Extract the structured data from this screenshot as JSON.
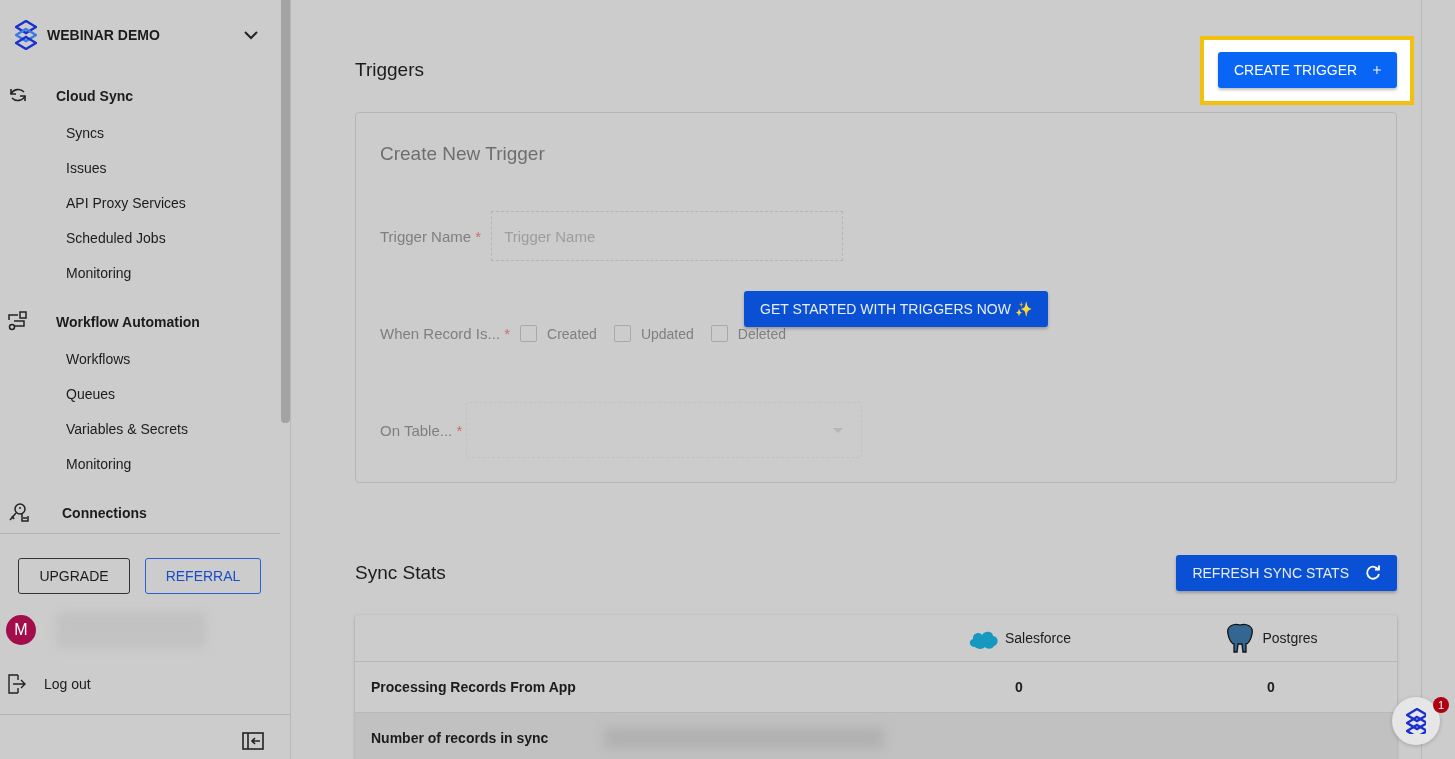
{
  "workspace": {
    "name": "WEBINAR DEMO"
  },
  "nav": [
    {
      "label": "Cloud Sync",
      "children": [
        {
          "label": "Syncs"
        },
        {
          "label": "Issues"
        },
        {
          "label": "API Proxy Services"
        },
        {
          "label": "Scheduled Jobs"
        },
        {
          "label": "Monitoring"
        }
      ]
    },
    {
      "label": "Workflow Automation",
      "children": [
        {
          "label": "Workflows"
        },
        {
          "label": "Queues"
        },
        {
          "label": "Variables & Secrets"
        },
        {
          "label": "Monitoring"
        }
      ]
    },
    {
      "label": "Connections"
    }
  ],
  "sidebar_buttons": [
    {
      "label": "UPGRADE",
      "kind": "dark"
    },
    {
      "label": "REFERRAL",
      "kind": "blue"
    }
  ],
  "user": {
    "initial": "M"
  },
  "logout": {
    "label": "Log out"
  },
  "triggers": {
    "title": "Triggers",
    "create_button": "CREATE TRIGGER",
    "form": {
      "title": "Create New Trigger",
      "cta": "GET STARTED WITH TRIGGERS NOW ✨",
      "fields": [
        {
          "kind": "text",
          "label": "Trigger Name",
          "mark": "*",
          "placeholder": "Trigger Name"
        },
        {
          "kind": "checkboxes",
          "label": "When Record Is...",
          "mark": "*",
          "options": [
            {
              "label": "Created",
              "checked": false
            },
            {
              "label": "Updated",
              "checked": false
            },
            {
              "label": "Deleted",
              "checked": false
            }
          ]
        },
        {
          "kind": "select",
          "label": "On Table...",
          "mark": "*"
        }
      ]
    }
  },
  "sync_stats": {
    "title": "Sync Stats",
    "refresh_button": "REFRESH SYNC STATS",
    "columns": [
      {
        "label": "Salesforce"
      },
      {
        "label": "Postgres"
      }
    ],
    "rows": [
      {
        "kind": "values",
        "label": "Processing Records From App",
        "values": [
          "0",
          "0"
        ]
      },
      {
        "kind": "redacted",
        "label": "Number of records in sync"
      }
    ]
  },
  "help": {
    "badge": "1"
  }
}
